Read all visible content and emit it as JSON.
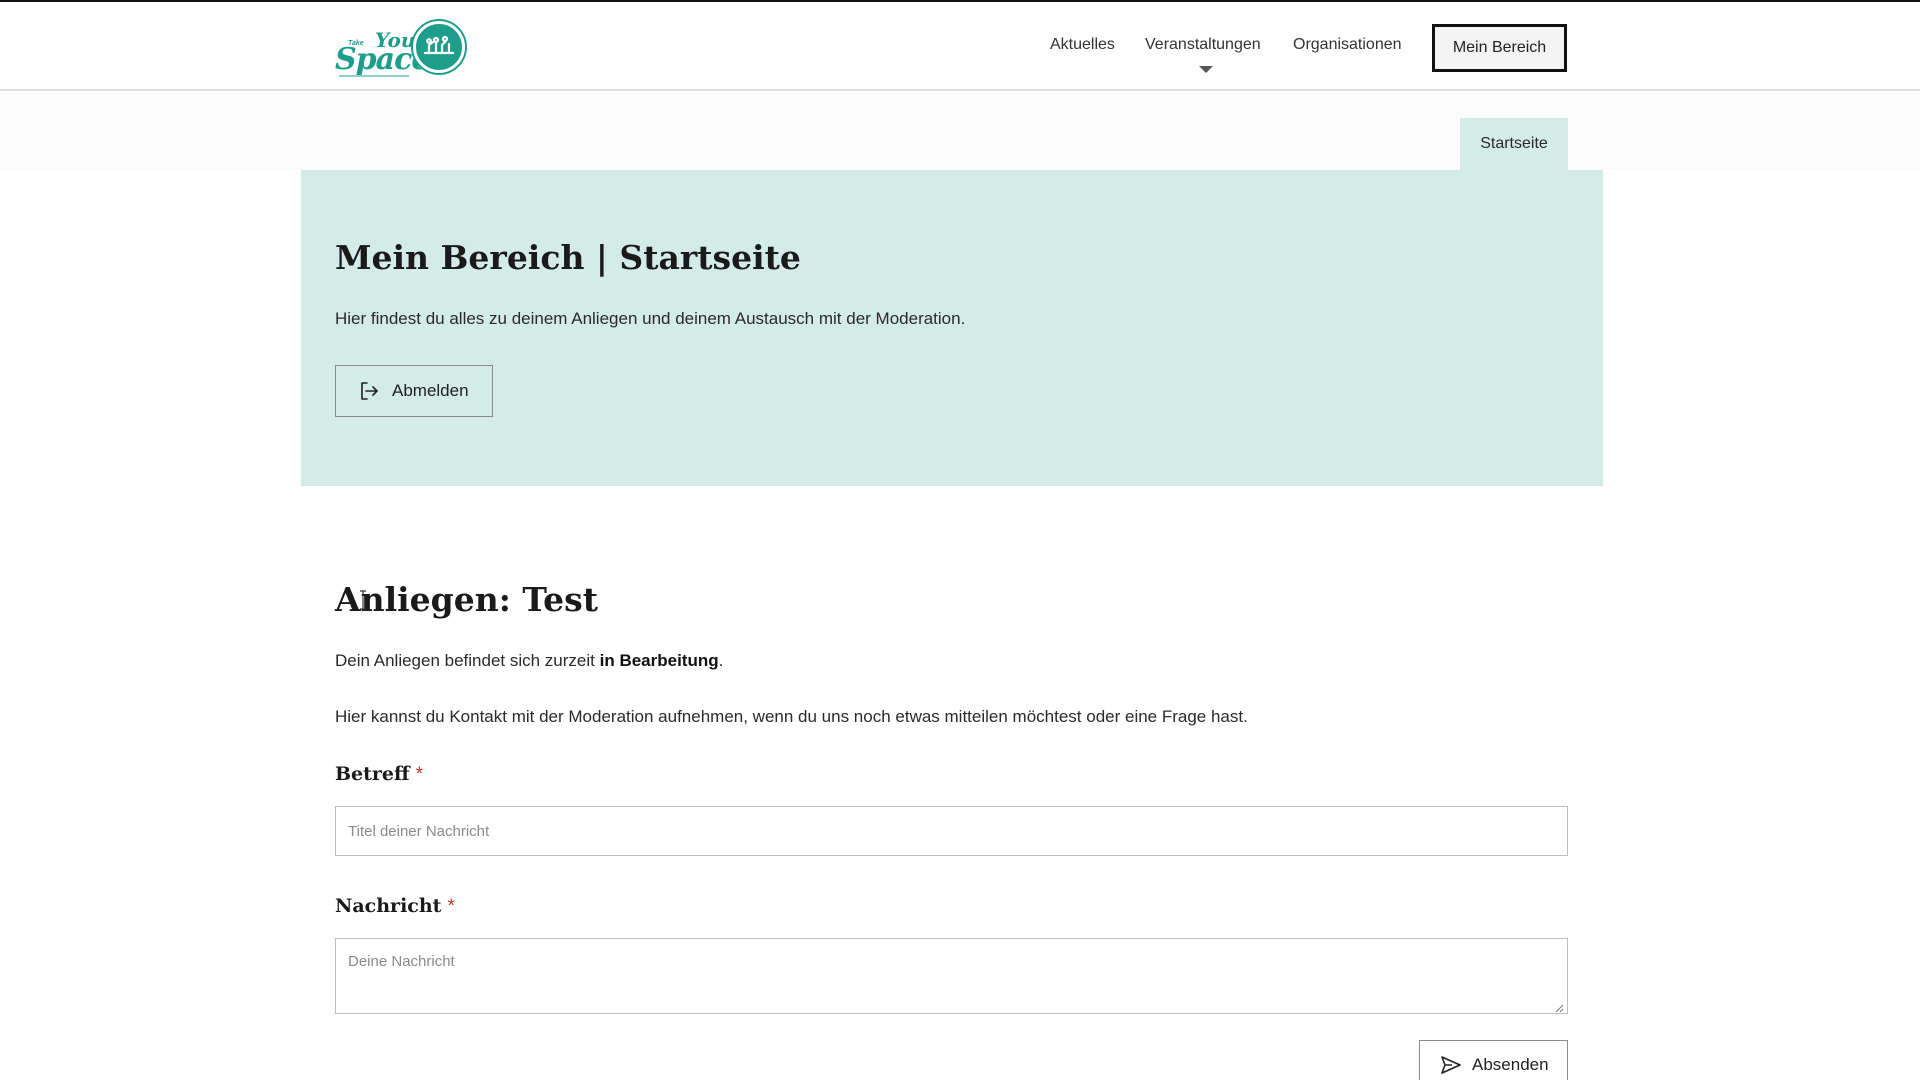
{
  "header": {
    "logo": {
      "name": "take-your-space-logo",
      "line_take": "Take",
      "line_your": "Your",
      "line_space": "Space"
    },
    "nav": [
      {
        "label": "Aktuelles"
      },
      {
        "label": "Veranstaltungen"
      },
      {
        "label": "Organisationen"
      }
    ],
    "mein_bereich_label": "Mein Bereich"
  },
  "breadcrumb_tab": "Startseite",
  "hero": {
    "title": "Mein Bereich | Startseite",
    "text": "Hier findest du alles zu deinem Anliegen und deinem Austausch mit der Moderation.",
    "logout_label": "Abmelden"
  },
  "anliegen": {
    "title": "Anliegen: Test",
    "status_prefix": "Dein Anliegen befindet sich zurzeit ",
    "status_value": "in Bearbeitung",
    "status_suffix": ".",
    "info": "Hier kannst du Kontakt mit der Moderation aufnehmen, wenn du uns noch etwas mitteilen möchtest oder eine Frage hast."
  },
  "form": {
    "betreff_label": "Betreff",
    "betreff_placeholder": "Titel deiner Nachricht",
    "betreff_value": "",
    "nachricht_label": "Nachricht",
    "nachricht_placeholder": "Deine Nachricht",
    "nachricht_value": "",
    "required_mark": "*",
    "send_label": "Absenden"
  },
  "colors": {
    "brand_teal": "#1e9e8a",
    "hero_bg": "#d3ece7",
    "required": "#c0392b"
  }
}
